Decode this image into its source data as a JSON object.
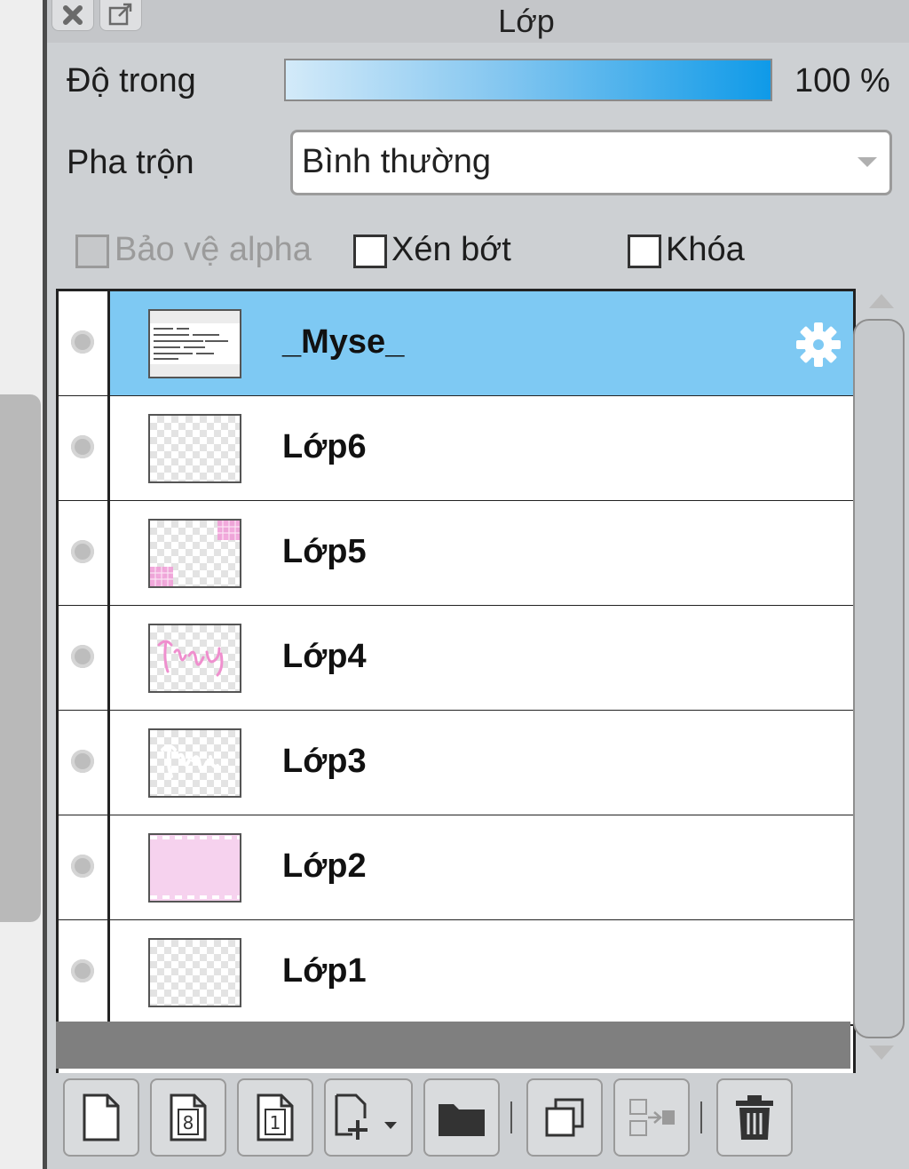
{
  "panel": {
    "title": "Lớp"
  },
  "opacity": {
    "label": "Độ trong",
    "value_text": "100 %",
    "level": 1.0
  },
  "blend": {
    "label": "Pha trộn",
    "selected": "Bình thường"
  },
  "options": {
    "protect_alpha": {
      "label": "Bảo vệ alpha",
      "checked": false,
      "enabled": false
    },
    "clip": {
      "label": "Xén bớt",
      "checked": false
    },
    "lock": {
      "label": "Khóa",
      "checked": false
    }
  },
  "layers": [
    {
      "name": "_Myse_",
      "selected": true,
      "thumb": "text",
      "gear": true
    },
    {
      "name": "Lớp6",
      "selected": false,
      "thumb": "empty"
    },
    {
      "name": "Lớp5",
      "selected": false,
      "thumb": "corners-pink"
    },
    {
      "name": "Lớp4",
      "selected": false,
      "thumb": "pink-script"
    },
    {
      "name": "Lớp3",
      "selected": false,
      "thumb": "white-script"
    },
    {
      "name": "Lớp2",
      "selected": false,
      "thumb": "pink-fill"
    },
    {
      "name": "Lớp1",
      "selected": false,
      "thumb": "empty"
    }
  ],
  "toolbar": {
    "icons": [
      "new-layer-icon",
      "new-8bit-layer-icon",
      "new-1bit-layer-icon",
      "new-layer-dropdown-icon",
      "new-folder-icon",
      "duplicate-icon",
      "merge-down-icon",
      "delete-icon"
    ]
  },
  "colors": {
    "selection": "#7ec9f3",
    "panel_bg": "#cdd0d3",
    "accent": "#0f9ae8",
    "pink": "#f6d2ee"
  }
}
